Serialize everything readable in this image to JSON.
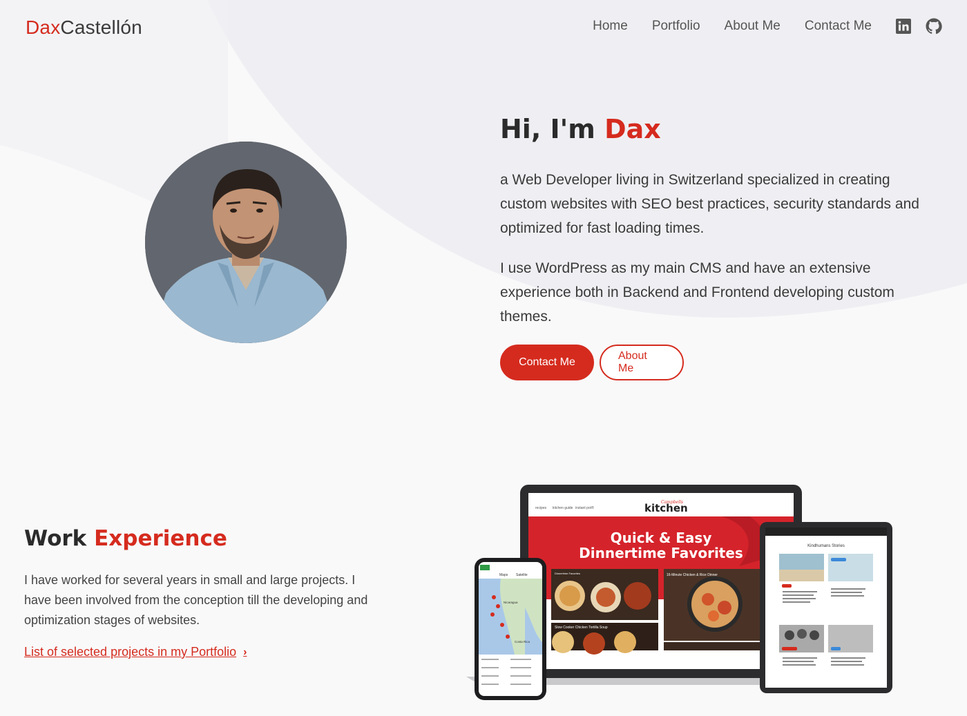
{
  "header": {
    "logo_first": "Dax",
    "logo_last": "Castellón",
    "nav": [
      "Home",
      "Portfolio",
      "About Me",
      "Contact Me"
    ],
    "social": [
      "linkedin-icon",
      "github-icon"
    ]
  },
  "hero": {
    "title_prefix": "Hi, I'm ",
    "title_name": "Dax",
    "paragraph1": "a Web Developer living in Switzerland specialized in creating custom websites with SEO best practices, security standards and optimized for fast loading times.",
    "paragraph2": "I use WordPress as my main CMS and have an extensive experience both in Backend and Frontend developing custom themes.",
    "btn_contact": "Contact Me",
    "btn_about": "About Me"
  },
  "work": {
    "title_prefix": "Work ",
    "title_accent": "Experience",
    "paragraph": "I have worked for several years in small and large projects. I have been involved from the conception till the developing and optimization stages of websites.",
    "link_text": "List of selected projects in my Portfolio"
  },
  "mockups": {
    "laptop_brand": "kitchen",
    "laptop_brand_script": "Campbells",
    "laptop_headline_1": "Quick & Easy",
    "laptop_headline_2": "Dinnertime Favorites",
    "laptop_nav": [
      "recipes",
      "kitchen guide",
      "instant pot®"
    ],
    "card1": "Dinnertime Favorites",
    "card2": "16-Minute Chicken & Rice Dinner",
    "card3": "Slow Cooker Chicken Tortilla Soup",
    "tablet_title": "Kindhumans Stories",
    "phone_tab1": "Maps",
    "phone_tab2": "Satelite",
    "phone_map_label1": "Nicaragua",
    "phone_map_label2": "Costa Rica"
  },
  "colors": {
    "accent": "#d52b1e",
    "text_dark": "#2b2b2b",
    "background": "#f9f9fa"
  }
}
